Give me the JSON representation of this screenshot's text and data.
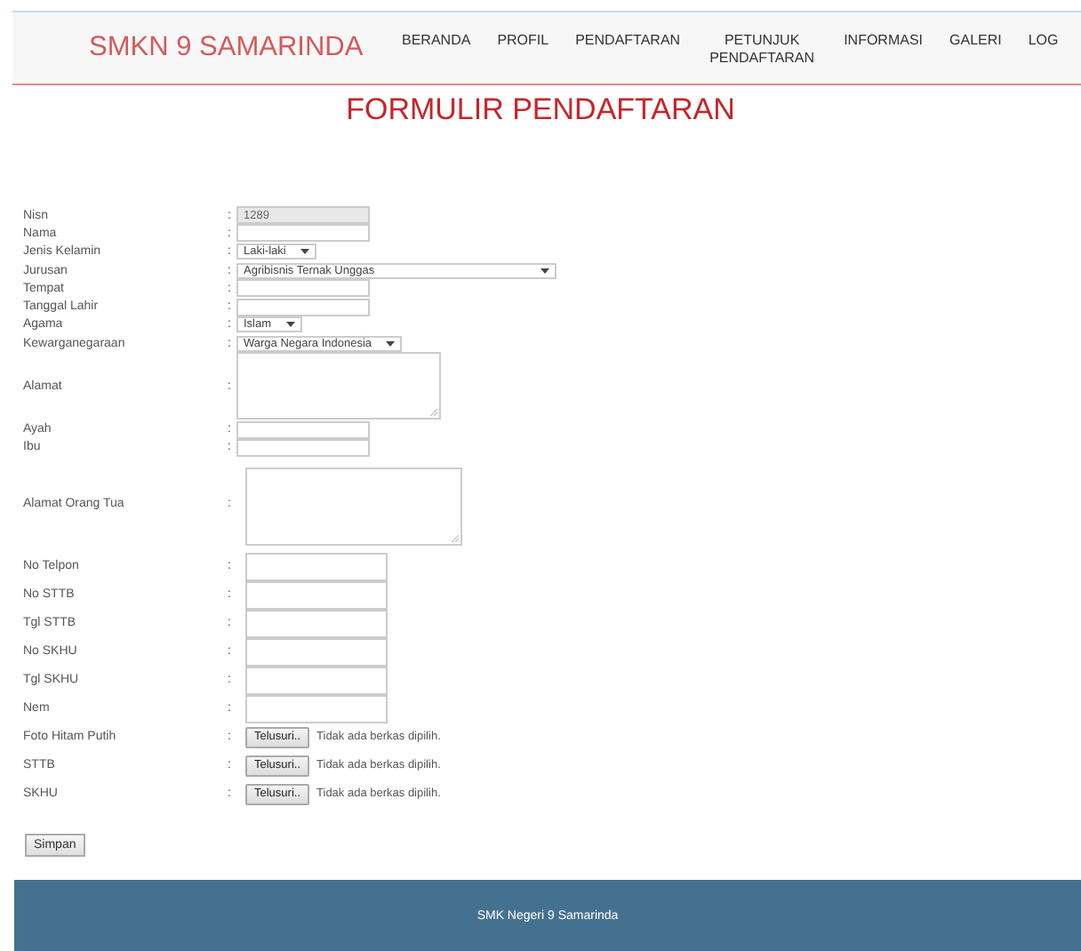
{
  "header": {
    "brand": "SMKN 9 SAMARINDA",
    "nav": [
      {
        "label": "BERANDA"
      },
      {
        "label": "PROFIL"
      },
      {
        "label": "PENDAFTARAN"
      },
      {
        "label": "PETUNJUK PENDAFTARAN"
      },
      {
        "label": "INFORMASI"
      },
      {
        "label": "GALERI"
      },
      {
        "label": "LOG"
      }
    ]
  },
  "title": "FORMULIR PENDAFTARAN",
  "fields": [
    {
      "label": "Nisn",
      "kind": "text",
      "value": "1289",
      "disabled": true
    },
    {
      "label": "Nama",
      "kind": "text",
      "disabled": false
    },
    {
      "label": "Jenis Kelamin",
      "kind": "select",
      "value": "Laki-laki",
      "wide": false
    },
    {
      "label": "Jurusan",
      "kind": "select",
      "value": "Agribisnis Ternak Unggas",
      "wide": true
    },
    {
      "label": "Tempat",
      "kind": "text",
      "disabled": false
    },
    {
      "label": "Tanggal Lahir",
      "kind": "text",
      "disabled": false
    },
    {
      "label": "Agama",
      "kind": "select",
      "value": "Islam",
      "wide": false
    },
    {
      "label": "Kewarganegaraan",
      "kind": "select",
      "value": "Warga Negara Indonesia",
      "wide": false
    },
    {
      "label": "Alamat",
      "kind": "textarea"
    },
    {
      "label": "Ayah",
      "kind": "text",
      "disabled": false
    },
    {
      "label": "Ibu",
      "kind": "text",
      "disabled": false
    }
  ],
  "parent_fields": [
    {
      "label": "Alamat Orang Tua",
      "kind": "textarea"
    },
    {
      "label": "No Telpon",
      "kind": "text",
      "disabled": false
    },
    {
      "label": "No STTB",
      "kind": "text",
      "disabled": false
    },
    {
      "label": "Tgl STTB",
      "kind": "text",
      "disabled": false
    },
    {
      "label": "No SKHU",
      "kind": "text",
      "disabled": false
    },
    {
      "label": "Tgl SKHU",
      "kind": "text",
      "disabled": false
    },
    {
      "label": "Nem",
      "kind": "text",
      "disabled": false
    },
    {
      "label": "Foto Hitam Putih",
      "kind": "file",
      "button": "Telusuri..",
      "note": "Tidak ada berkas dipilih."
    },
    {
      "label": "STTB",
      "kind": "file",
      "button": "Telusuri..",
      "note": "Tidak ada berkas dipilih."
    },
    {
      "label": "SKHU",
      "kind": "file",
      "button": "Telusuri..",
      "note": "Tidak ada berkas dipilih."
    }
  ],
  "colon": ":",
  "submit": "Simpan",
  "footer": "SMK Negeri 9 Samarinda"
}
